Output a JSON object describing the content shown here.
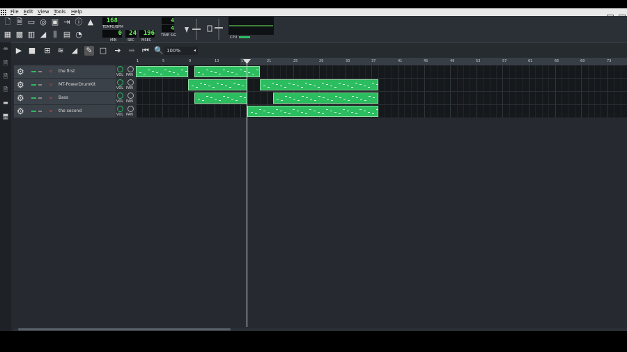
{
  "menu": [
    "File",
    "Edit",
    "View",
    "Tools",
    "Help"
  ],
  "window": {
    "restore": "▫",
    "close": "×"
  },
  "transport": {
    "tempo": "168",
    "tempo_label": "TEMPO/BPM",
    "min": "0",
    "min_label": "MIN",
    "sec": "24",
    "sec_label": "SEC",
    "msec": "196",
    "msec_label": "MSEC",
    "timesig_num": "4",
    "timesig_den": "4",
    "timesig_label": "TIME SIG",
    "cpu_label": "CPU"
  },
  "song_toolbar": {
    "zoom": "100%"
  },
  "ruler": [
    "1",
    "5",
    "9",
    "13",
    "17",
    "21",
    "25",
    "29",
    "33",
    "37",
    "41",
    "45",
    "49",
    "53",
    "57",
    "61",
    "65",
    "69",
    "73"
  ],
  "tracks": [
    {
      "name": "the first",
      "vol": "VOL",
      "pan": "PAN"
    },
    {
      "name": "MT-PowerDrumKit",
      "vol": "VOL",
      "pan": "PAN"
    },
    {
      "name": "Bass",
      "vol": "VOL",
      "pan": "PAN"
    },
    {
      "name": "the second",
      "vol": "VOL",
      "pan": "PAN"
    }
  ],
  "colors": {
    "clip": "#2bbd5f",
    "lcd_text": "#6cf25d",
    "panel": "#3b4148"
  }
}
